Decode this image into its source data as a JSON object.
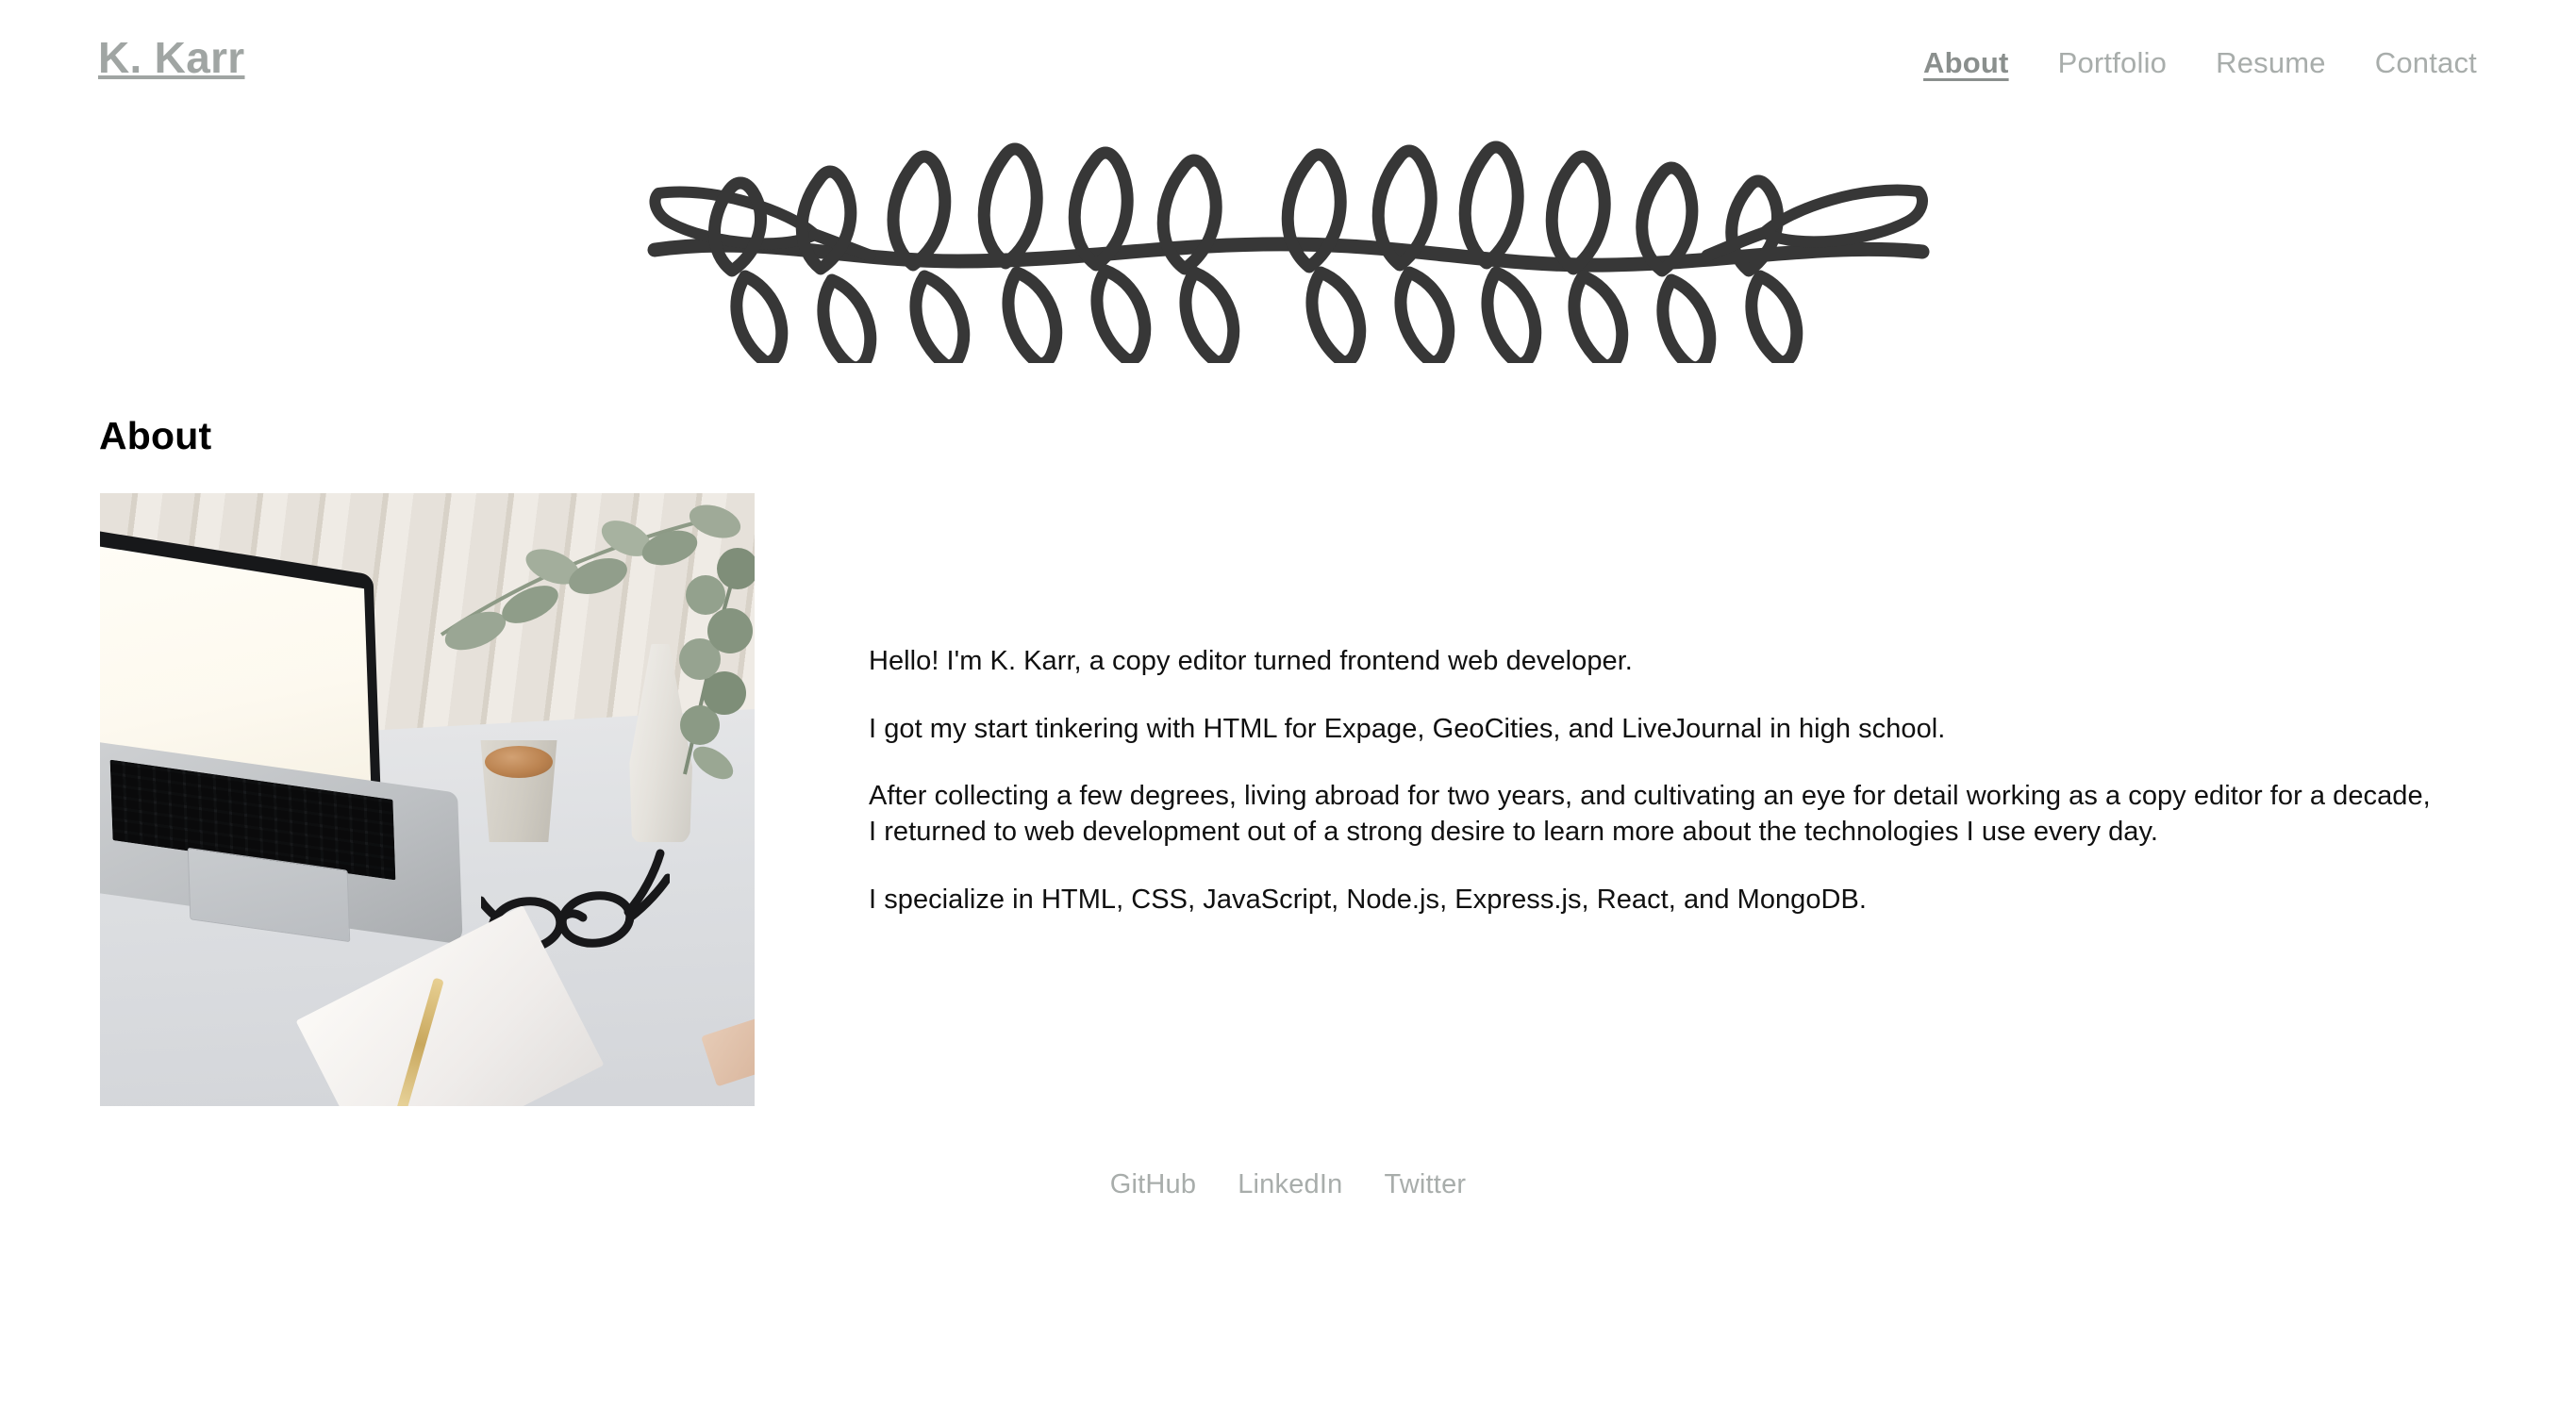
{
  "site": {
    "brand": "K. Karr",
    "brand_color": "#a0a5a3",
    "background_color": "#ffffff",
    "body_text_color": "#101010",
    "muted_color": "#a8adab",
    "active_nav_color": "#8a8f8d",
    "ornament_color": "#373737"
  },
  "nav": {
    "items": [
      {
        "label": "About",
        "active": true
      },
      {
        "label": "Portfolio",
        "active": false
      },
      {
        "label": "Resume",
        "active": false
      },
      {
        "label": "Contact",
        "active": false
      }
    ]
  },
  "ornament": {
    "name": "laurel-branch-divider",
    "description": "Hand-drawn leafy branch divider with looped leaves above and below a wavy stem"
  },
  "main": {
    "heading": "About",
    "image": {
      "alt": "Open laptop on a white desk with a coffee cup, eucalyptus in a vase, black eyeglasses, a notebook and a gold pen"
    },
    "paragraphs": [
      "Hello! I'm K. Karr, a copy editor turned frontend web developer.",
      "I got my start tinkering with HTML for Expage, GeoCities, and LiveJournal in high school.",
      "After collecting a few degrees, living abroad for two years, and cultivating an eye for detail working as a copy editor for a decade, I returned to web development out of a strong desire to learn more about the technologies I use every day.",
      "I specialize in HTML, CSS, JavaScript, Node.js, Express.js, React, and MongoDB."
    ]
  },
  "footer": {
    "links": [
      {
        "label": "GitHub"
      },
      {
        "label": "LinkedIn"
      },
      {
        "label": "Twitter"
      }
    ]
  }
}
